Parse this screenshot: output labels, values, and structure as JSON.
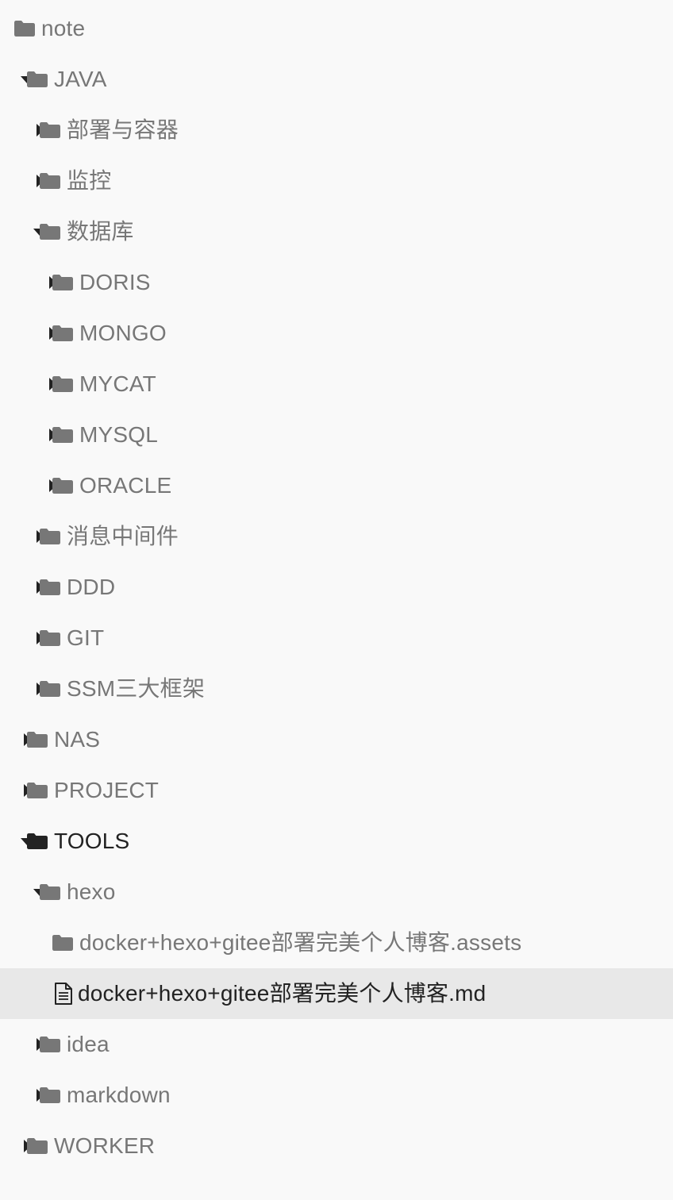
{
  "colors": {
    "background": "#f9f9f9",
    "selected_row": "#e8e8e8",
    "label_muted": "#777777",
    "label_active": "#222222",
    "folder_muted": "#777777",
    "folder_active": "#222222"
  },
  "tree": {
    "items": [
      {
        "label": "note",
        "depth": 0,
        "type": "folder",
        "expanded": null,
        "active": false,
        "selected": false
      },
      {
        "label": "JAVA",
        "depth": 1,
        "type": "folder",
        "expanded": true,
        "active": false,
        "selected": false
      },
      {
        "label": "部署与容器",
        "depth": 2,
        "type": "folder",
        "expanded": false,
        "active": false,
        "selected": false
      },
      {
        "label": "监控",
        "depth": 2,
        "type": "folder",
        "expanded": false,
        "active": false,
        "selected": false
      },
      {
        "label": "数据库",
        "depth": 2,
        "type": "folder",
        "expanded": true,
        "active": false,
        "selected": false
      },
      {
        "label": "DORIS",
        "depth": 3,
        "type": "folder",
        "expanded": false,
        "active": false,
        "selected": false
      },
      {
        "label": "MONGO",
        "depth": 3,
        "type": "folder",
        "expanded": false,
        "active": false,
        "selected": false
      },
      {
        "label": "MYCAT",
        "depth": 3,
        "type": "folder",
        "expanded": false,
        "active": false,
        "selected": false
      },
      {
        "label": "MYSQL",
        "depth": 3,
        "type": "folder",
        "expanded": false,
        "active": false,
        "selected": false
      },
      {
        "label": "ORACLE",
        "depth": 3,
        "type": "folder",
        "expanded": false,
        "active": false,
        "selected": false
      },
      {
        "label": "消息中间件",
        "depth": 2,
        "type": "folder",
        "expanded": false,
        "active": false,
        "selected": false
      },
      {
        "label": "DDD",
        "depth": 2,
        "type": "folder",
        "expanded": false,
        "active": false,
        "selected": false
      },
      {
        "label": "GIT",
        "depth": 2,
        "type": "folder",
        "expanded": false,
        "active": false,
        "selected": false
      },
      {
        "label": "SSM三大框架",
        "depth": 2,
        "type": "folder",
        "expanded": false,
        "active": false,
        "selected": false
      },
      {
        "label": "NAS",
        "depth": 1,
        "type": "folder",
        "expanded": false,
        "active": false,
        "selected": false
      },
      {
        "label": "PROJECT",
        "depth": 1,
        "type": "folder",
        "expanded": false,
        "active": false,
        "selected": false
      },
      {
        "label": "TOOLS",
        "depth": 1,
        "type": "folder",
        "expanded": true,
        "active": true,
        "selected": false
      },
      {
        "label": "hexo",
        "depth": 2,
        "type": "folder",
        "expanded": true,
        "active": false,
        "selected": false
      },
      {
        "label": "docker+hexo+gitee部署完美个人博客.assets",
        "depth": 3,
        "type": "folder",
        "expanded": null,
        "active": false,
        "selected": false
      },
      {
        "label": "docker+hexo+gitee部署完美个人博客.md",
        "depth": 3,
        "type": "file",
        "expanded": null,
        "active": true,
        "selected": true
      },
      {
        "label": "idea",
        "depth": 2,
        "type": "folder",
        "expanded": false,
        "active": false,
        "selected": false
      },
      {
        "label": "markdown",
        "depth": 2,
        "type": "folder",
        "expanded": false,
        "active": false,
        "selected": false
      },
      {
        "label": "WORKER",
        "depth": 1,
        "type": "folder",
        "expanded": false,
        "active": false,
        "selected": false
      }
    ]
  }
}
